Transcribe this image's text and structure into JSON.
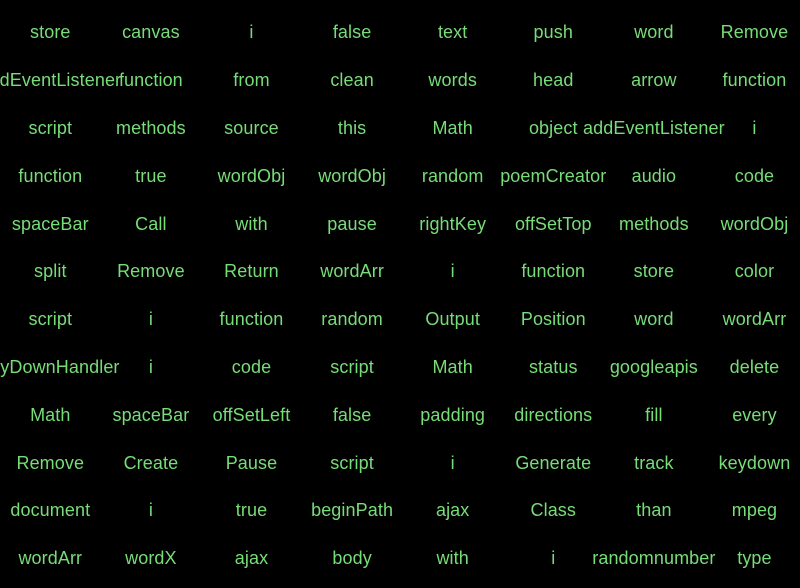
{
  "text_color": "#77dd77",
  "background_color": "#000000",
  "rows": [
    [
      "store",
      "canvas",
      "i",
      "false",
      "text",
      "push",
      "word",
      "Remove"
    ],
    [
      "addEventListener",
      "function",
      "from",
      "clean",
      "words",
      "head",
      "arrow",
      "function"
    ],
    [
      "script",
      "methods",
      "source",
      "this",
      "Math",
      "object",
      "addEventListener",
      "i"
    ],
    [
      "function",
      "true",
      "wordObj",
      "wordObj",
      "random",
      "poemCreator",
      "audio",
      "code"
    ],
    [
      "spaceBar",
      "Call",
      "with",
      "pause",
      "rightKey",
      "offSetTop",
      "methods",
      "wordObj"
    ],
    [
      "split",
      "Remove",
      "Return",
      "wordArr",
      "i",
      "function",
      "store",
      "color"
    ],
    [
      "script",
      "i",
      "function",
      "random",
      "Output",
      "Position",
      "word",
      "wordArr"
    ],
    [
      "keyDownHandler",
      "i",
      "code",
      "script",
      "Math",
      "status",
      "googleapis",
      "delete"
    ],
    [
      "Math",
      "spaceBar",
      "offSetLeft",
      "false",
      "padding",
      "directions",
      "fill",
      "every"
    ],
    [
      "Remove",
      "Create",
      "Pause",
      "script",
      "i",
      "Generate",
      "track",
      "keydown"
    ],
    [
      "document",
      "i",
      "true",
      "beginPath",
      "ajax",
      "Class",
      "than",
      "mpeg"
    ],
    [
      "wordArr",
      "wordX",
      "ajax",
      "body",
      "with",
      "i",
      "randomnumber",
      "type"
    ]
  ]
}
